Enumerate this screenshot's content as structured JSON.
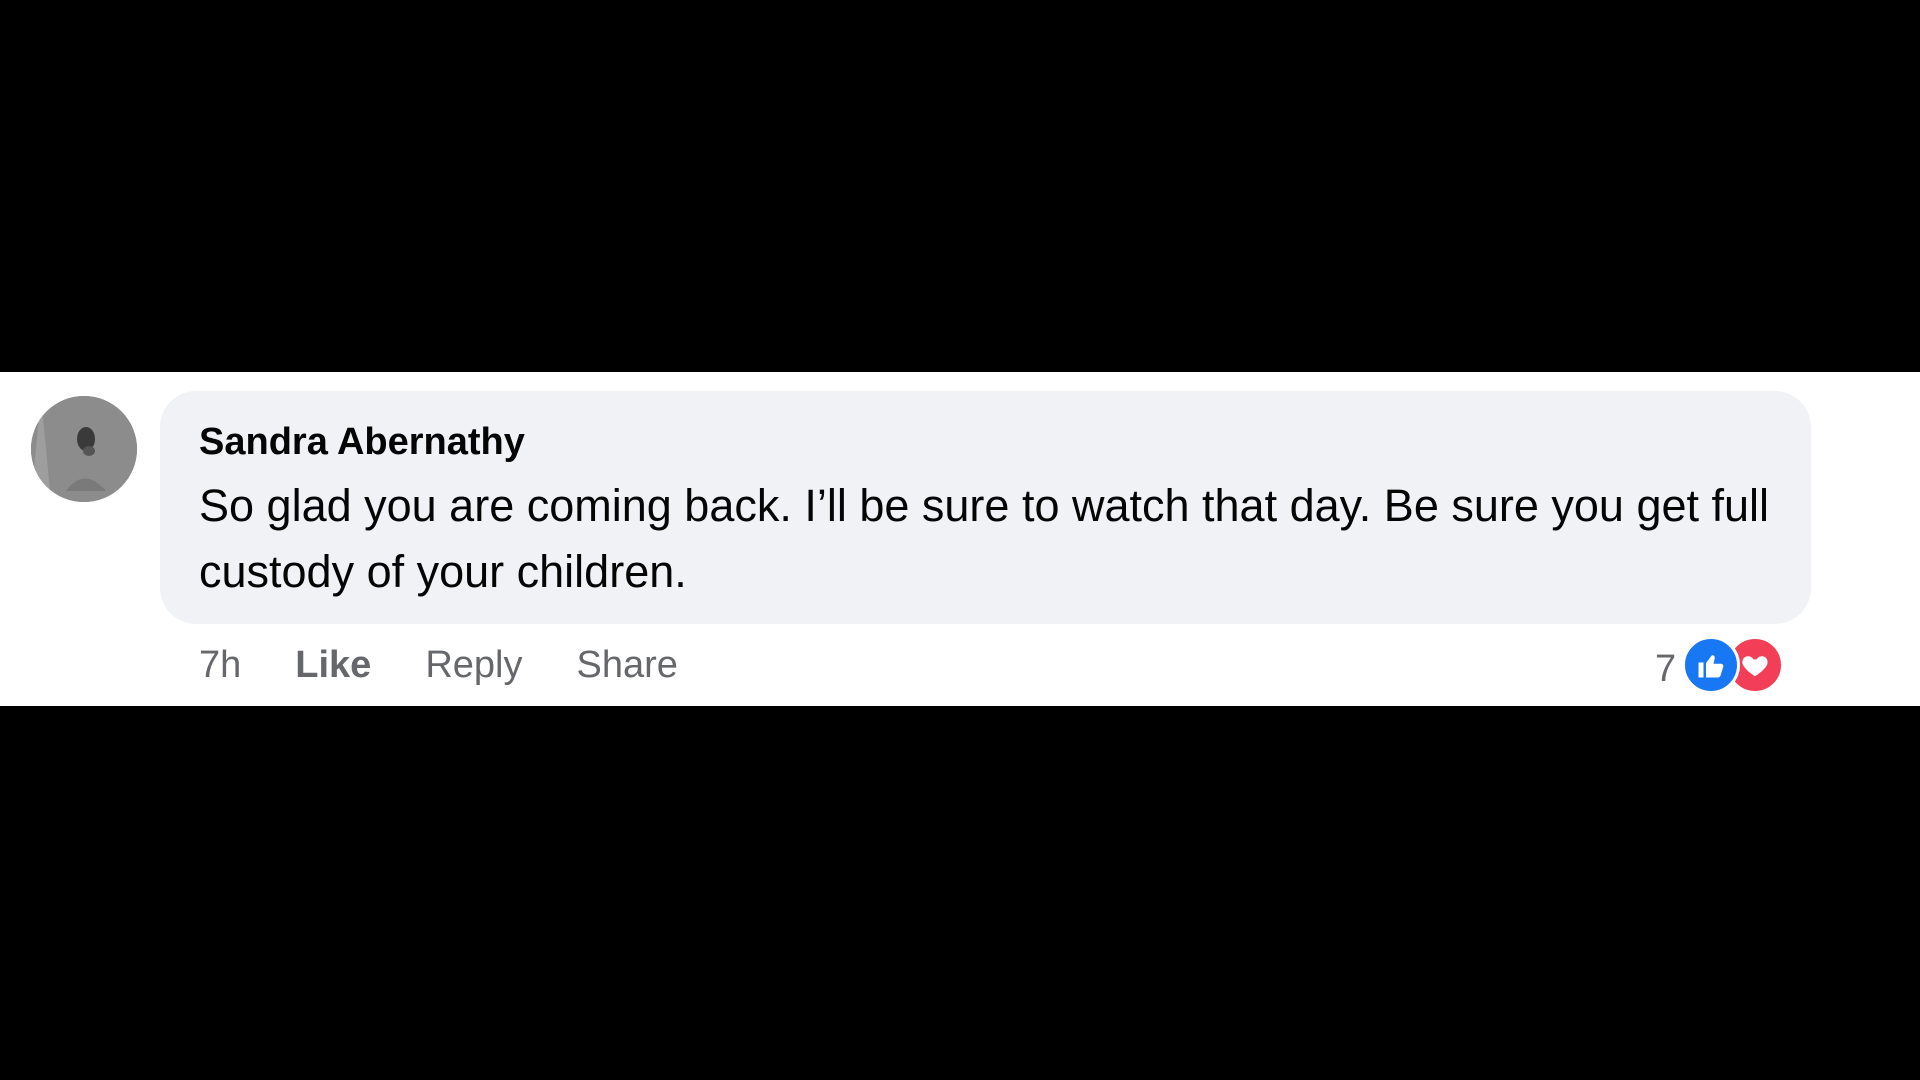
{
  "comment": {
    "author": "Sandra Abernathy",
    "text": "So glad you are coming back. I’ll be sure to watch that day. Be sure you get full custody of your children.",
    "timestamp": "7h",
    "actions": {
      "like": "Like",
      "reply": "Reply",
      "share": "Share"
    },
    "reactions": {
      "count": "7",
      "icons": [
        "like-icon",
        "love-icon"
      ]
    },
    "avatar_icon": "avatar-photo"
  },
  "colors": {
    "background": "#000000",
    "strip": "#ffffff",
    "bubble": "#f0f2f5",
    "text": "#050505",
    "muted": "#65676b",
    "like_blue": "#1877f2",
    "love_red": "#f33e58"
  }
}
